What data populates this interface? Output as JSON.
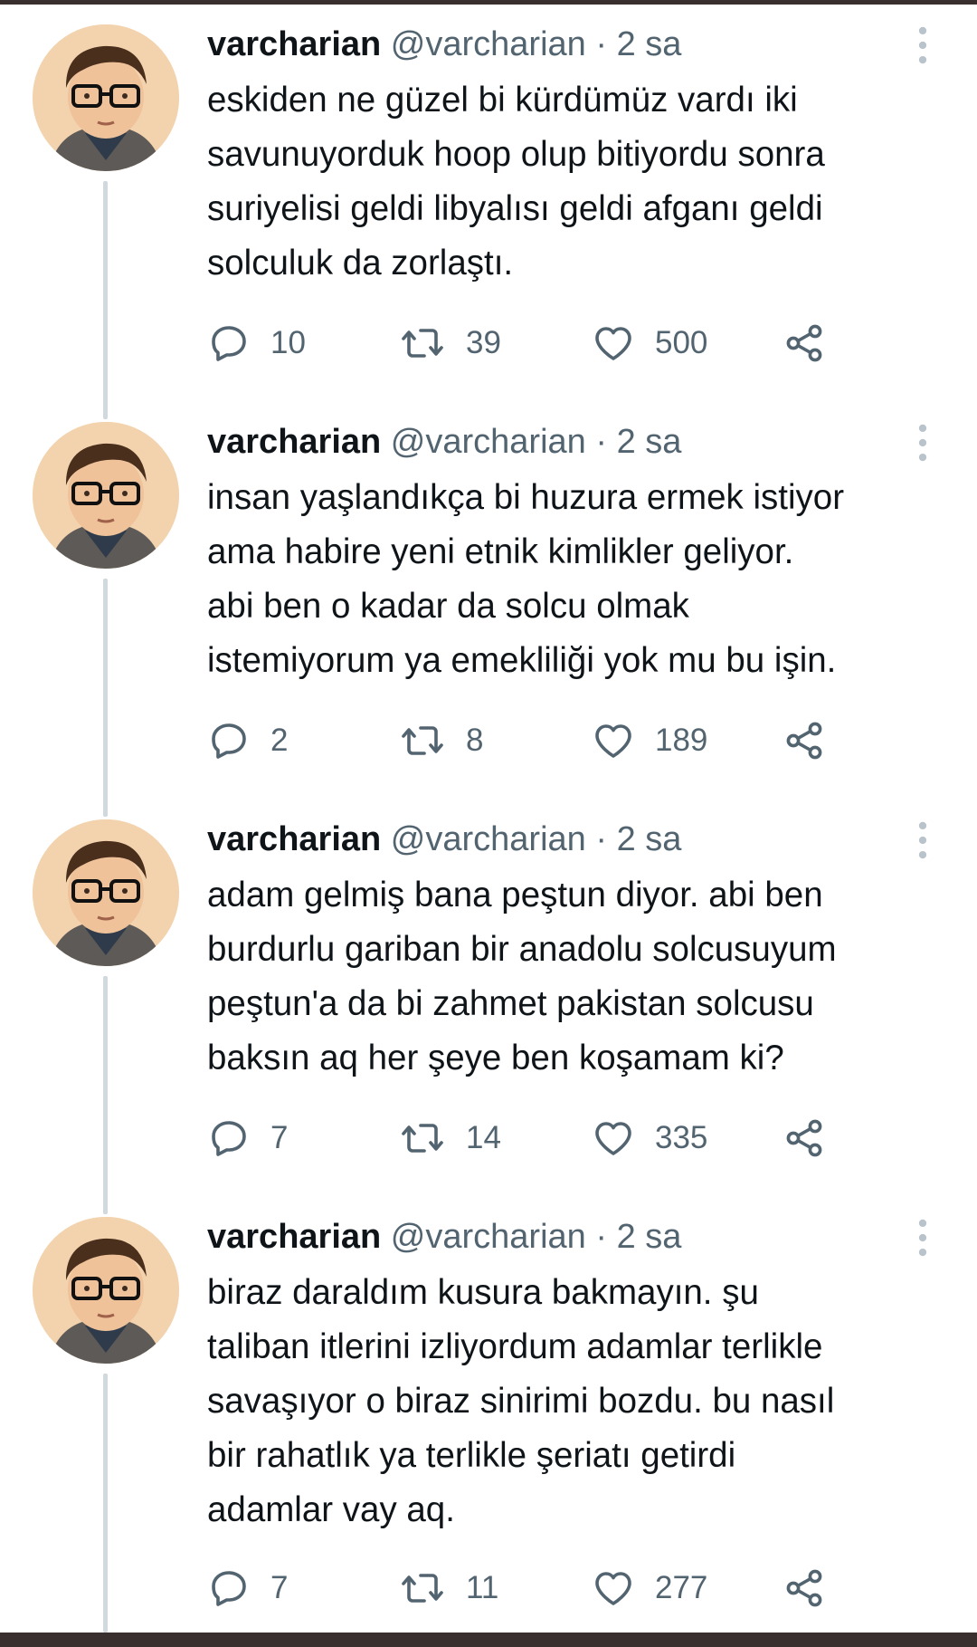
{
  "tweets": [
    {
      "name": "varcharian",
      "handle": "@varcharian",
      "separator": "·",
      "time": "2 sa",
      "text": "eskiden ne güzel bi kürdümüz vardı iki\nsavunuyorduk hoop olup bitiyordu sonra\nsuriyelisi geldi libyalısı geldi afganı geldi\nsolculuk da zorlaştı.",
      "replies": "10",
      "retweets": "39",
      "likes": "500"
    },
    {
      "name": "varcharian",
      "handle": "@varcharian",
      "separator": "·",
      "time": "2 sa",
      "text": "insan yaşlandıkça bi huzura ermek istiyor\nama habire yeni etnik kimlikler geliyor.\nabi ben o kadar da solcu olmak\nistemiyorum ya emekliliği yok mu bu işin.",
      "replies": "2",
      "retweets": "8",
      "likes": "189"
    },
    {
      "name": "varcharian",
      "handle": "@varcharian",
      "separator": "·",
      "time": "2 sa",
      "text": "adam gelmiş bana peştun diyor. abi ben\nburdurlu gariban bir anadolu solcusuyum\npeştun'a da bi zahmet pakistan solcusu\nbaksın aq her şeye ben koşamam ki?",
      "replies": "7",
      "retweets": "14",
      "likes": "335"
    },
    {
      "name": "varcharian",
      "handle": "@varcharian",
      "separator": "·",
      "time": "2 sa",
      "text": "biraz daraldım kusura bakmayın. şu\ntaliban itlerini izliyordum adamlar terlikle\nsavaşıyor o biraz sinirimi bozdu. bu nasıl\nbir rahatlık ya terlikle şeriatı getirdi\nadamlar vay aq.",
      "replies": "7",
      "retweets": "11",
      "likes": "277"
    }
  ],
  "icons": {
    "reply": "speech-bubble-icon",
    "retweet": "retweet-arrows-icon",
    "like": "heart-icon",
    "share": "share-nodes-icon",
    "more": "vertical-dots-icon"
  },
  "colors": {
    "text_primary": "#0f1419",
    "text_secondary": "#536471",
    "thread_line": "#cfd9de",
    "outer_frame": "#3a2f2f"
  }
}
